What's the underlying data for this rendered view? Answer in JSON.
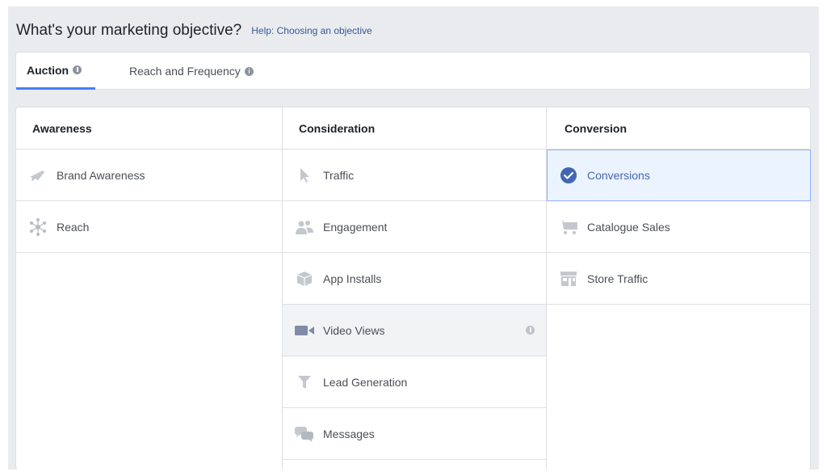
{
  "header": {
    "title": "What's your marketing objective?",
    "help_link": "Help: Choosing an objective"
  },
  "tabs": [
    {
      "label": "Auction",
      "active": true
    },
    {
      "label": "Reach and Frequency",
      "active": false
    }
  ],
  "columns": [
    {
      "heading": "Awareness",
      "options": [
        {
          "label": "Brand Awareness",
          "icon": "megaphone-icon"
        },
        {
          "label": "Reach",
          "icon": "network-icon"
        }
      ]
    },
    {
      "heading": "Consideration",
      "options": [
        {
          "label": "Traffic",
          "icon": "cursor-icon"
        },
        {
          "label": "Engagement",
          "icon": "people-icon"
        },
        {
          "label": "App Installs",
          "icon": "box-icon"
        },
        {
          "label": "Video Views",
          "icon": "video-camera-icon",
          "state": "hover"
        },
        {
          "label": "Lead Generation",
          "icon": "funnel-icon"
        },
        {
          "label": "Messages",
          "icon": "chat-bubbles-icon"
        }
      ]
    },
    {
      "heading": "Conversion",
      "options": [
        {
          "label": "Conversions",
          "icon": "check-circle-icon",
          "state": "selected"
        },
        {
          "label": "Catalogue Sales",
          "icon": "shopping-cart-icon"
        },
        {
          "label": "Store Traffic",
          "icon": "store-icon"
        }
      ]
    }
  ],
  "colors": {
    "accent": "#4080ff",
    "selected_text": "#4267b2",
    "icon_gray": "#bec3c9"
  }
}
